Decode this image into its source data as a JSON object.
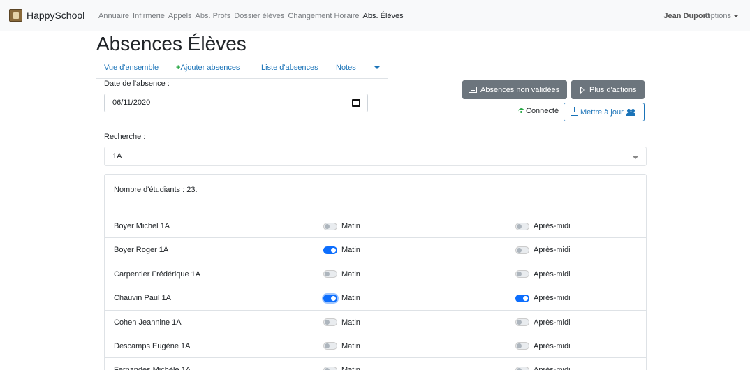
{
  "navbar": {
    "brand": "HappySchool",
    "links": [
      "Annuaire",
      "Infirmerie",
      "Appels",
      "Abs. Profs",
      "Dossier élèves",
      "Changement Horaire",
      "Abs. Élèves"
    ],
    "active_link": "Abs. Élèves",
    "user": "Jean Dupont",
    "options": "Options"
  },
  "page_title": "Absences Élèves",
  "tabs": [
    "Vue d'ensemble",
    "Ajouter absences",
    "Liste d'absences",
    "Notes"
  ],
  "date": {
    "label": "Date de l'absence :",
    "value": "06/11/2020"
  },
  "actions": {
    "non_validees": "Absences non validées",
    "plus_actions": "Plus d'actions",
    "connected": "Connecté",
    "update": "Mettre à jour"
  },
  "search": {
    "label": "Recherche :",
    "value": "1A"
  },
  "students_count_text": "Nombre d'étudiants : 23.",
  "labels": {
    "morning": "Matin",
    "afternoon": "Après-midi"
  },
  "students": [
    {
      "name": "Boyer Michel 1A",
      "morning": false,
      "afternoon": false
    },
    {
      "name": "Boyer Roger 1A",
      "morning": true,
      "afternoon": false
    },
    {
      "name": "Carpentier Frédérique 1A",
      "morning": false,
      "afternoon": false
    },
    {
      "name": "Chauvin Paul 1A",
      "morning": true,
      "afternoon": true
    },
    {
      "name": "Cohen Jeannine 1A",
      "morning": false,
      "afternoon": false
    },
    {
      "name": "Descamps Eugène 1A",
      "morning": false,
      "afternoon": false
    },
    {
      "name": "Fernandes Michèle 1A",
      "morning": false,
      "afternoon": false
    }
  ],
  "colors": {
    "primary": "#0d6efd",
    "link": "#1a73b8",
    "secondary": "#6c757d",
    "success": "#28a745"
  }
}
